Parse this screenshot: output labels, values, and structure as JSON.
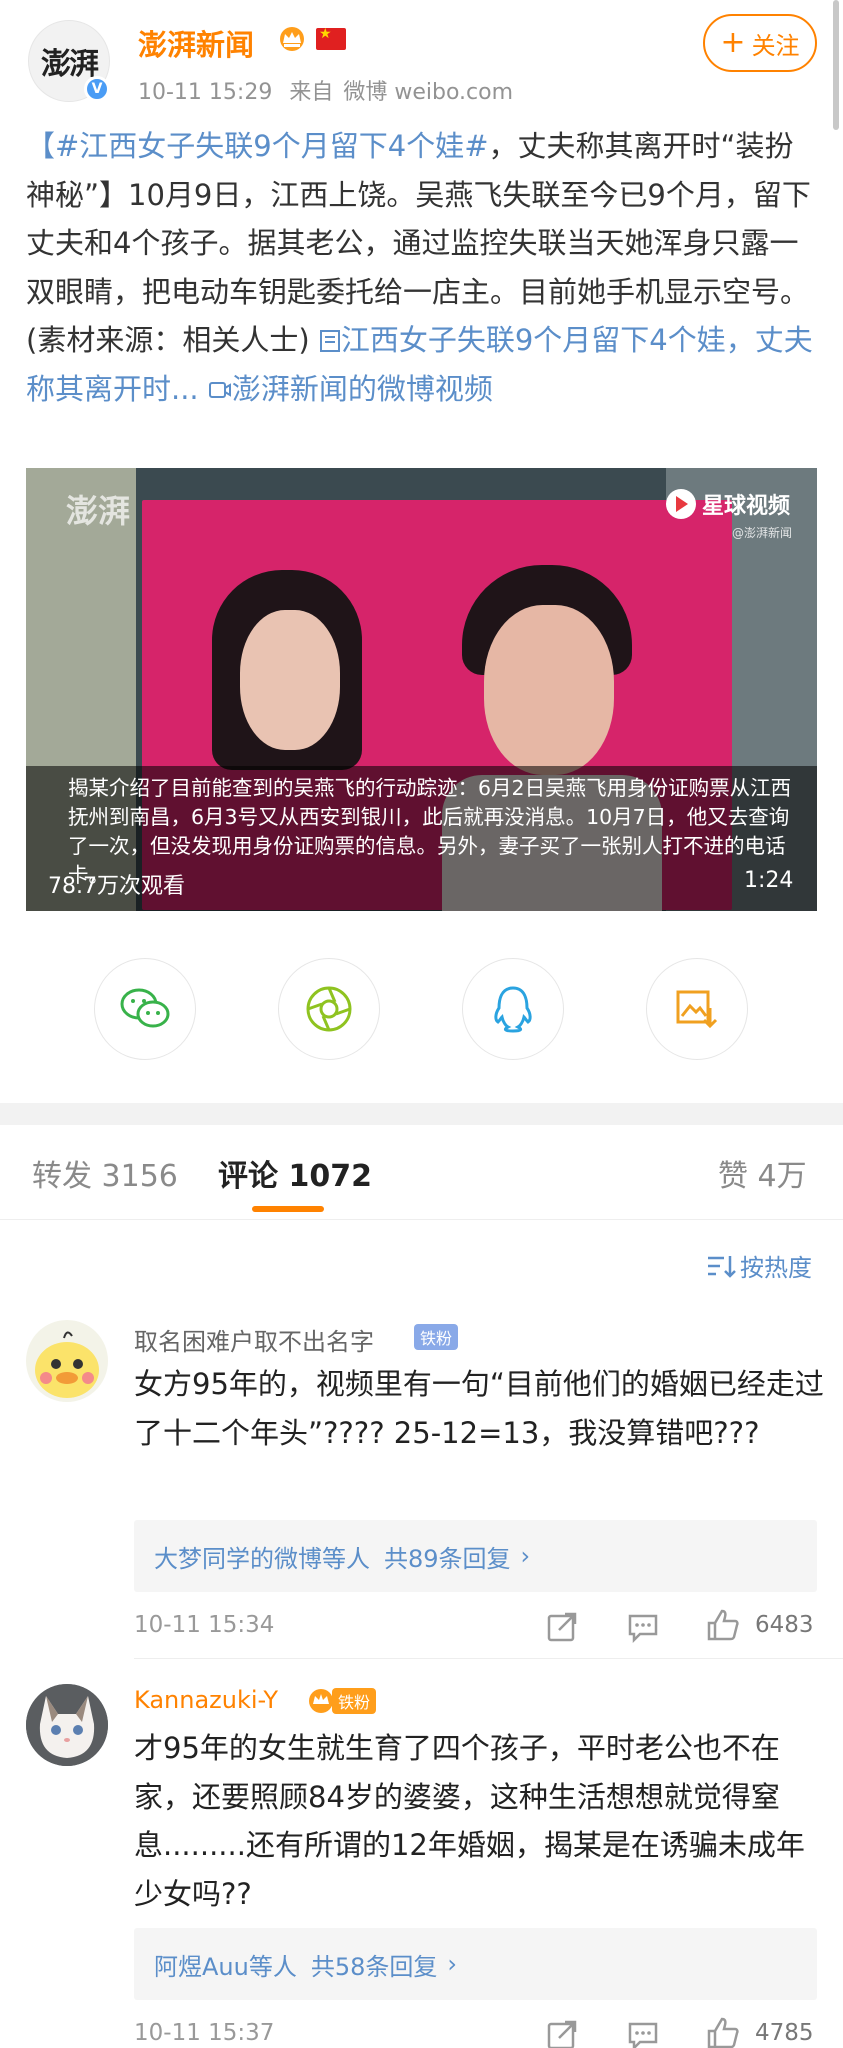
{
  "post": {
    "author": "澎湃新闻",
    "avatar_text": "澎湃",
    "time": "10-11 15:29",
    "source_prefix": "来自",
    "source": "微博 weibo.com",
    "follow_label": "关注",
    "text_hashtag": "【#江西女子失联9个月留下4个娃#",
    "text_body": "，丈夫称其离开时“装扮神秘”】10月9日，江西上饶。吴燕飞失联至今已9个月，留下丈夫和4个孩子。据其老公，通过监控失联当天她浑身只露一双眼睛，把电动车钥匙委托给一店主。目前她手机显示空号。(素材来源：相关人士) ",
    "link1": "江西女子失联9个月留下4个娃，丈夫称其离开时...",
    "link2": "澎湃新闻的微博视频"
  },
  "video": {
    "watermark": "澎湃",
    "brand": "星球视频",
    "brand_sub": "@澎湃新闻",
    "subtitle": "揭某介绍了目前能查到的吴燕飞的行动踪迹：6月2日吴燕飞用身份证购票从江西抚州到南昌，6月3号又从西安到银川，此后就再没消息。10月7日，他又去查询了一次，但没发现用身份证购票的信息。另外，妻子买了一张别人打不进的电话卡。",
    "views": "78.7万次观看",
    "duration": "1:24"
  },
  "share": [
    "wechat-icon",
    "moments-icon",
    "qq-icon",
    "save-image-icon"
  ],
  "tabs": {
    "repost_label": "转发",
    "repost_count": "3156",
    "comment_label": "评论",
    "comment_count": "1072",
    "like_label": "赞",
    "like_count": "4万"
  },
  "sort_label": "按热度",
  "comments": [
    {
      "name": "取名困难户取不出名字",
      "badge": "铁粉",
      "text": "女方95年的，视频里有一句“目前他们的婚姻已经走过了十二个年头”???? 25-12=13，我没算错吧???",
      "replies_users": "大梦同学的微博等人",
      "replies_count": "共89条回复",
      "time": "10-11 15:34",
      "likes": "6483"
    },
    {
      "name": "Kannazuki-Y",
      "badge": "铁粉",
      "text": "才95年的女生就生育了四个孩子，平时老公也不在家，还要照顾84岁的婆婆，这种生活想想就觉得窒息.........还有所谓的12年婚姻，揭某是在诱骗未成年少女吗??",
      "replies_users": "阿煜Auu等人",
      "replies_count": "共58条回复",
      "time": "10-11 15:37",
      "likes": "4785"
    }
  ],
  "colors": {
    "accent": "#ff8200",
    "link": "#5b8ec9",
    "badge": "#89a9e8"
  }
}
